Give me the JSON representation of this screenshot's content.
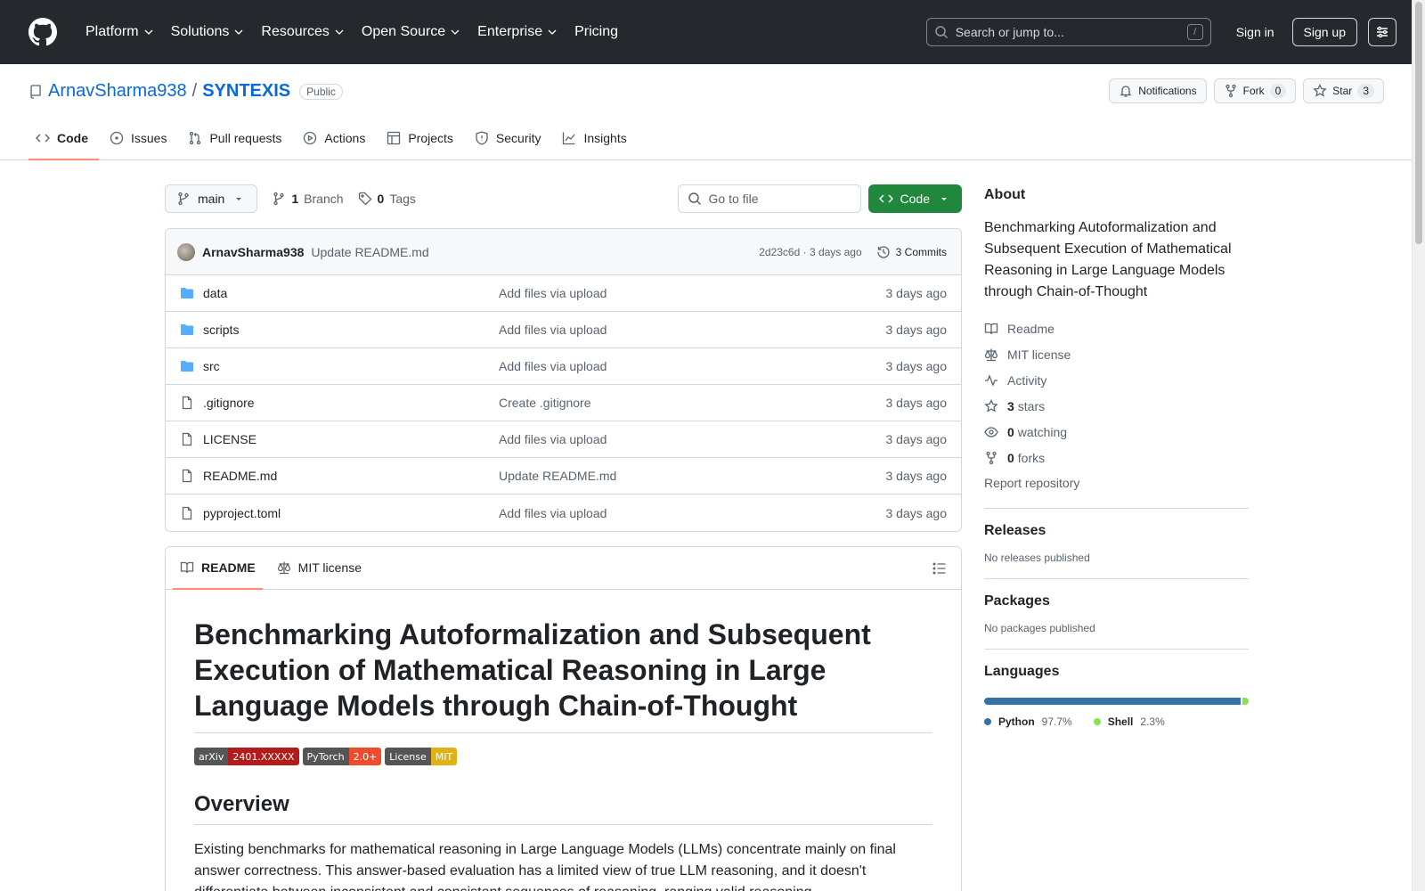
{
  "header": {
    "nav": [
      "Platform",
      "Solutions",
      "Resources",
      "Open Source",
      "Enterprise",
      "Pricing"
    ],
    "search_placeholder": "Search or jump to...",
    "slash": "/",
    "sign_in": "Sign in",
    "sign_up": "Sign up"
  },
  "repo": {
    "owner": "ArnavSharma938",
    "sep": "/",
    "name": "SYNTEXIS",
    "visibility": "Public",
    "notifications": "Notifications",
    "fork_label": "Fork",
    "fork_count": "0",
    "star_label": "Star",
    "star_count": "3",
    "tabs": [
      "Code",
      "Issues",
      "Pull requests",
      "Actions",
      "Projects",
      "Security",
      "Insights"
    ]
  },
  "toolbar": {
    "branch": "main",
    "branch_count": "1",
    "branch_label": "Branch",
    "tag_count": "0",
    "tag_label": "Tags",
    "goto_placeholder": "Go to file",
    "code_button": "Code"
  },
  "commit": {
    "author": "ArnavSharma938",
    "message": "Update README.md",
    "meta": "2d23c6d · 3 days ago",
    "count": "3 Commits"
  },
  "files": [
    {
      "name": "data",
      "type": "dir",
      "commit": "Add files via upload",
      "time": "3 days ago"
    },
    {
      "name": "scripts",
      "type": "dir",
      "commit": "Add files via upload",
      "time": "3 days ago"
    },
    {
      "name": "src",
      "type": "dir",
      "commit": "Add files via upload",
      "time": "3 days ago"
    },
    {
      "name": ".gitignore",
      "type": "file",
      "commit": "Create .gitignore",
      "time": "3 days ago"
    },
    {
      "name": "LICENSE",
      "type": "file",
      "commit": "Add files via upload",
      "time": "3 days ago"
    },
    {
      "name": "README.md",
      "type": "file",
      "commit": "Update README.md",
      "time": "3 days ago"
    },
    {
      "name": "pyproject.toml",
      "type": "file",
      "commit": "Add files via upload",
      "time": "3 days ago"
    }
  ],
  "readme": {
    "tab_readme": "README",
    "tab_license": "MIT license",
    "title": "Benchmarking Autoformalization and Subsequent Execution of Mathematical Reasoning in Large Language Models through Chain-of-Thought",
    "shields": [
      {
        "label": "arXiv",
        "value": "2401.XXXXX",
        "color": "#b31b1b"
      },
      {
        "label": "PyTorch",
        "value": "2.0+",
        "color": "#ee4c2c"
      },
      {
        "label": "License",
        "value": "MIT",
        "color": "#dfb317"
      }
    ],
    "overview_heading": "Overview",
    "overview_text": "Existing benchmarks for mathematical reasoning in Large Language Models (LLMs) concentrate mainly on final answer correctness. This answer-based evaluation has a limited view of true LLM reasoning, and it doesn't differentiate between inconsistent and consistent sequences of reasoning, ranging valid reasoning"
  },
  "about": {
    "heading": "About",
    "description": "Benchmarking Autoformalization and Subsequent Execution of Mathematical Reasoning in Large Language Models through Chain-of-Thought",
    "readme": "Readme",
    "license": "MIT license",
    "activity": "Activity",
    "stars_count": "3",
    "stars_label": "stars",
    "watching_count": "0",
    "watching_label": "watching",
    "forks_count": "0",
    "forks_label": "forks",
    "report": "Report repository"
  },
  "releases": {
    "heading": "Releases",
    "text": "No releases published"
  },
  "packages": {
    "heading": "Packages",
    "text": "No packages published"
  },
  "languages": {
    "heading": "Languages",
    "items": [
      {
        "name": "Python",
        "percent": "97.7%",
        "value": 97.7,
        "color": "#3572A5"
      },
      {
        "name": "Shell",
        "percent": "2.3%",
        "value": 2.3,
        "color": "#89e051"
      }
    ]
  }
}
